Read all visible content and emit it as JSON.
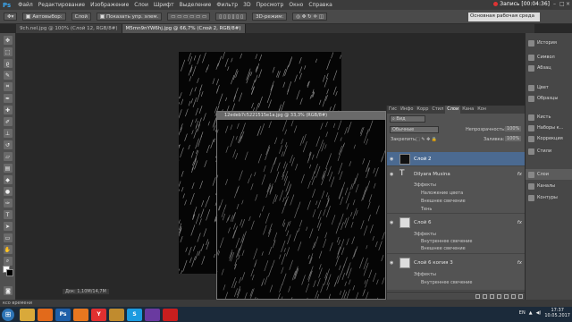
{
  "menubar": {
    "logo": "Ps",
    "items": [
      "Файл",
      "Редактирование",
      "Изображение",
      "Слои",
      "Шрифт",
      "Выделение",
      "Фильтр",
      "3D",
      "Просмотр",
      "Окно",
      "Справка"
    ],
    "record_label": "Запись [00:04:36]"
  },
  "options": {
    "autoselect_label": "Автовыбор:",
    "autoselect_value": "Слой",
    "show_controls_label": "Показать упр. элем.",
    "mode_3d_label": "3D-режим:",
    "workspace": "Основная рабочая среда"
  },
  "tabs": [
    {
      "label": "9ch.nel.jpg @ 100% (Слой 12, RGB/8#)"
    },
    {
      "label": "M5mn9nYW6hj.jpg @ 66,7% (Слой 2, RGB/8#)"
    }
  ],
  "float_doc": {
    "title": "12edeb7c5221515e1a.jpg @ 33,3% (RGB/8#)"
  },
  "layers_panel": {
    "tabs": [
      "Гис",
      "Инфо",
      "Корр",
      "Стил",
      "Слои",
      "Кана",
      "Кон"
    ],
    "active_tab": "Слои",
    "kind_label": "Вид",
    "blend_mode": "Обычные",
    "opacity_label": "Непрозрачность:",
    "opacity_value": "100%",
    "lock_label": "Закрепить:",
    "fill_label": "Заливка:",
    "fill_value": "100%",
    "layers": [
      {
        "name": "Слой 2",
        "selected": true,
        "fx": ""
      },
      {
        "name": "Dilyara Musina",
        "type": "text",
        "fx": "fx",
        "effects_label": "Эффекты",
        "effects": [
          "Наложение цвета",
          "Внешнее свечение",
          "Тень"
        ]
      },
      {
        "name": "Слой 6",
        "fx": "fx",
        "effects_label": "Эффекты",
        "effects": [
          "Внутреннее свечение",
          "Внешнее свечение"
        ]
      },
      {
        "name": "Слой 6 копия 3",
        "fx": "fx",
        "effects_label": "Эффекты",
        "effects": [
          "Внутреннее свечение"
        ]
      }
    ]
  },
  "dock": {
    "items": [
      "История",
      "Символ",
      "Абзац",
      "Цвет",
      "Образцы",
      "Кисть",
      "Наборы к...",
      "Коррекция",
      "Стили",
      "Слои",
      "Каналы",
      "Контуры"
    ],
    "selected": "Слои"
  },
  "status": {
    "zoom": "Док: 1,10М/14,7М",
    "left": "ксо времени"
  },
  "taskbar": {
    "apps": [
      {
        "name": "windows-explorer",
        "color": "#d9a93a"
      },
      {
        "name": "media-player",
        "color": "#e26a1b"
      },
      {
        "name": "photoshop",
        "color": "#1f5fa8",
        "glyph": "Ps"
      },
      {
        "name": "firefox",
        "color": "#e8771f"
      },
      {
        "name": "yandex-browser",
        "color": "#e03030",
        "glyph": "Y"
      },
      {
        "name": "folder",
        "color": "#c08b2e"
      },
      {
        "name": "skype",
        "color": "#1c9be0",
        "glyph": "S"
      },
      {
        "name": "media-app",
        "color": "#6a3aa0"
      },
      {
        "name": "recorder",
        "color": "#c81e1e"
      }
    ],
    "lang": "EN",
    "time": "17:37",
    "date": "10.05.2017"
  }
}
